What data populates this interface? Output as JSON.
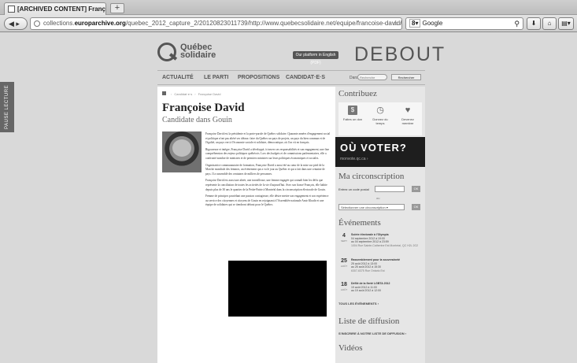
{
  "browser": {
    "tab_title": "[ARCHIVED CONTENT] François...",
    "new_tab": "+",
    "url_prefix": "collections.",
    "url_domain": "europarchive.org",
    "url_rest": "/quebec_2012_capture_2/20120823011739/http://www.quebecsolidaire.net/equipe/francoise-david/",
    "search_engine": "Google",
    "icons": [
      "back-icon",
      "globe-icon",
      "star-icon",
      "reload-icon",
      "search-icon",
      "download-icon",
      "home-icon"
    ]
  },
  "left_strip": "PAUSE LECTURE",
  "site": {
    "logo_line1": "Québec",
    "logo_line2": "solidaire",
    "lang_pill": "Our platform in English (PDF)",
    "slogan": "DEBOUT"
  },
  "nav": {
    "items": [
      "ACTUALITÉ",
      "LE PARTI",
      "PROPOSITIONS",
      "CANDIDAT·E·S"
    ],
    "search_label": "Dans",
    "search_placeholder": "Recherche",
    "search_button": "Rechercher"
  },
  "breadcrumb": [
    "Candidat·e·s",
    "Françoise David"
  ],
  "candidate": {
    "name": "Françoise David",
    "subtitle": "Candidate dans Gouin",
    "paragraphs": [
      "Françoise David est la présidente et la porte-parole de Québec solidaire. Quarante années d'engagement social et politique n'ont pas altéré ses idéaux: faire du Québec un pays de projets, un pays du bien commun et de l'égalité, un pays vert à l'économie sociale et solidaire, démocratique, où l'on vit en français.",
      "Rigoureuse et intègre, Françoise David a développé, à travers ses responsabilités et son engagement, une fine compréhension des enjeux politiques québécois. Lors des budgets et de commissions parlementaires, elle a confronté nombre de ministres et de premiers ministres sur leurs politiques économiques et sociales.",
      "Organisatrice communautaire de formation, Françoise David a aussi été au cœur de la mise sur pied de la Marche mondiale des femmes, un événement qui a vu le jour au Québec et qui a fait dans une centaine de pays. Il a rassemblé des centaines de milliers de personnes.",
      "Françoise David est aussi une aînée, une travailleuse, une femme engagée qui connaît bien les défis que représente la conciliation de toutes les activités de la vie d'aujourd'hui. Avec son fiancé François, elle habite depuis plus de 30 ans le quartier de la Petite-Patrie à Montréal dans la circonscription électorale de Gouin.",
      "Femme de principes possédant une passion contagieuse, elle désire mettre son engagement et son expérience au service des citoyennes et citoyens de Gouin en rejoignant à l'Assemblée nationale Amir Khadir et une équipe de solidaires qui se tiendront debout pour le Québec."
    ]
  },
  "sidebar": {
    "contribuez_title": "Contribuez",
    "contrib_items": [
      {
        "icon": "money-icon",
        "label": "Faites un don"
      },
      {
        "icon": "clock-icon",
        "label": "Donnez du temps"
      },
      {
        "icon": "heart-icon",
        "label": "Devenez membre"
      }
    ],
    "ouvoter": "OÙ VOTER?",
    "ouvoter_site": "monvote.qc.ca",
    "circ_title": "Ma circonscription",
    "postal_label": "Entrez un code postal",
    "ok_label": "OK",
    "or_label": "ou",
    "select_label": "Sélectionner une circonscription",
    "events_title": "Événements",
    "events": [
      {
        "day": "4",
        "month": "SEPT",
        "title": "Soirée électorale à l'Olympia",
        "when": "04 septembre 2012 à 19:00",
        "when2": "au 04 septembre 2012 à 23:59",
        "loc": "1004 Rue Sainte-Catherine Est Montréal, QC H2L 2G2"
      },
      {
        "day": "25",
        "month": "AOÛT",
        "title": "Rassemblement pour la souveraineté",
        "when": "25 août 2012 à 13:00",
        "when2": "au 25 août 2012 à 15:30",
        "loc": "6307-6375 Rue Ontario Est"
      },
      {
        "day": "18",
        "month": "AOÛT",
        "title": "Défilé de la fierté LGBTA 2012",
        "when": "19 août 2012 à 11:00",
        "when2": "au 19 août 2012 à 12:00",
        "loc": ""
      }
    ],
    "all_events": "TOUS LES ÉVÉNEMENTS",
    "liste_title": "Liste de diffusion",
    "liste_link": "S'INSCRIRE À NOTRE LISTE DE DIFFUSION",
    "videos_title": "Vidéos"
  }
}
